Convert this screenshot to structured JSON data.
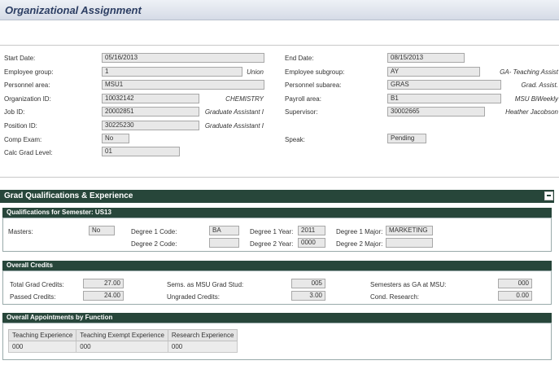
{
  "header": {
    "title": "Organizational Assignment"
  },
  "assignment": {
    "start_date": {
      "label": "Start Date:",
      "value": "05/16/2013"
    },
    "end_date": {
      "label": "End Date:",
      "value": "08/15/2013"
    },
    "employee_group": {
      "label": "Employee group:",
      "value": "1",
      "desc": "Union"
    },
    "employee_subgroup": {
      "label": "Employee subgroup:",
      "value": "AY",
      "desc": "GA- Teaching Assist"
    },
    "personnel_area": {
      "label": "Personnel area:",
      "value": "MSU1"
    },
    "personnel_subarea": {
      "label": "Personnel subarea:",
      "value": "GRAS",
      "desc": "Grad. Assist."
    },
    "organization_id": {
      "label": "Organization ID:",
      "value": "10032142",
      "desc": "CHEMISTRY"
    },
    "payroll_area": {
      "label": "Payroll area:",
      "value": "B1",
      "desc": "MSU BiWeekly"
    },
    "job_id": {
      "label": "Job ID:",
      "value": "20002851",
      "desc": "Graduate Assistant I"
    },
    "supervisor": {
      "label": "Supervisor:",
      "value": "30002665",
      "desc": "Heather  Jacobson"
    },
    "position_id": {
      "label": "Position ID:",
      "value": "30225230",
      "desc": "Graduate Assistant I"
    },
    "comp_exam": {
      "label": "Comp Exam:",
      "value": "No"
    },
    "speak": {
      "label": "Speak:",
      "value": "Pending"
    },
    "calc_grad_level": {
      "label": "Calc Grad Level:",
      "value": "01"
    }
  },
  "grad": {
    "title": "Grad Qualifications & Experience",
    "qualifications": {
      "title": "Qualifications for Semester: US13",
      "masters_label": "Masters:",
      "masters_value": "No",
      "degree1_code_label": "Degree 1 Code:",
      "degree1_code_value": "BA",
      "degree1_year_label": "Degree 1 Year:",
      "degree1_year_value": "2011",
      "degree1_major_label": "Degree 1 Major:",
      "degree1_major_value": "MARKETING",
      "degree2_code_label": "Degree 2 Code:",
      "degree2_code_value": "",
      "degree2_year_label": "Degree 2 Year:",
      "degree2_year_value": "0000",
      "degree2_major_label": "Degree 2 Major:",
      "degree2_major_value": ""
    },
    "credits": {
      "title": "Overall Credits",
      "total_label": "Total Grad Credits:",
      "total_value": "27.00",
      "passed_label": "Passed Credits:",
      "passed_value": "24.00",
      "sems_label": "Sems. as MSU Grad Stud:",
      "sems_value": "005",
      "ungraded_label": "Ungraded Credits:",
      "ungraded_value": "3.00",
      "semesters_ga_label": "Semesters as GA at MSU:",
      "semesters_ga_value": "000",
      "cond_research_label": "Cond. Research:",
      "cond_research_value": "0.00"
    },
    "appointments": {
      "title": "Overall Appointments by Function",
      "headers": [
        "Teaching Experience",
        "Teaching Exempt Experience",
        "Research Experience"
      ],
      "values": [
        "000",
        "000",
        "000"
      ]
    }
  }
}
